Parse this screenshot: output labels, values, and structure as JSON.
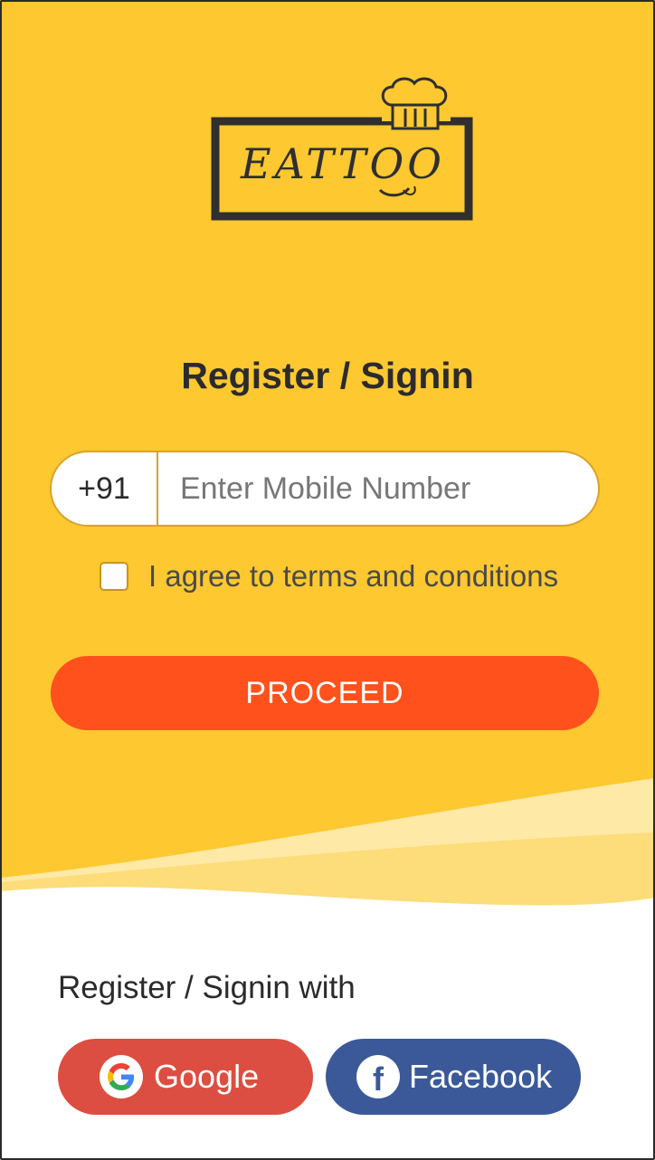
{
  "brand": {
    "logo_text": "EATTOO"
  },
  "heading": "Register / Signin",
  "phone": {
    "country_code": "+91",
    "placeholder": "Enter Mobile Number",
    "value": ""
  },
  "terms": {
    "label": "I agree to terms and conditions",
    "checked": false
  },
  "proceed_label": "PROCEED",
  "social": {
    "title": "Register / Signin with",
    "google_label": "Google",
    "facebook_label": "Facebook"
  },
  "colors": {
    "background_yellow": "#FDC830",
    "proceed": "#FF511C",
    "google": "#DC4E41",
    "facebook": "#3B5998"
  },
  "icons": [
    "chef-hat-icon",
    "google-icon",
    "facebook-icon"
  ]
}
